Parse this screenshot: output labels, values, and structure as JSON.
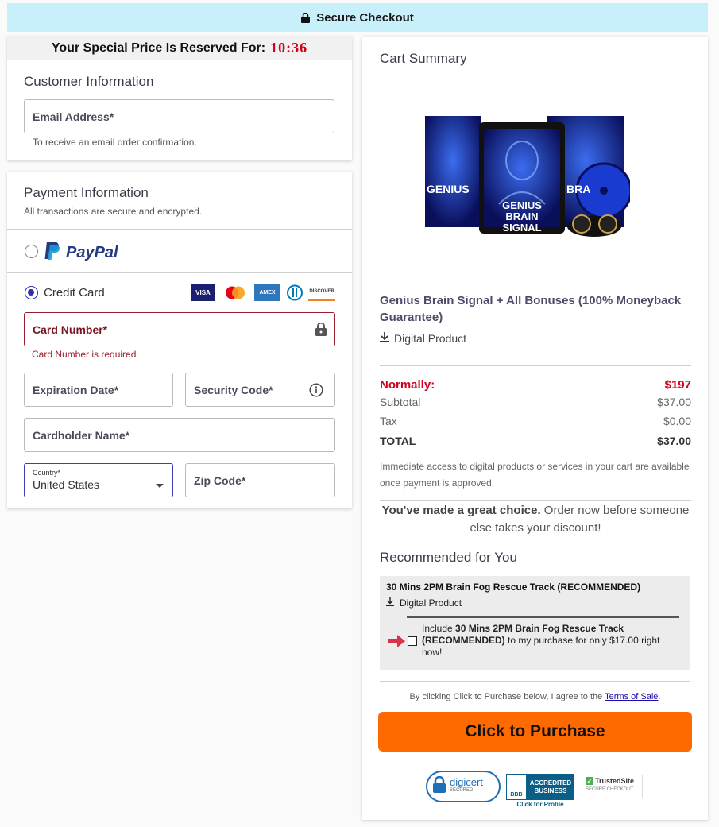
{
  "topbar": {
    "label": "Secure Checkout"
  },
  "timer": {
    "label": "Your Special Price Is Reserved For:",
    "time": "10:36"
  },
  "customer": {
    "title": "Customer Information",
    "email_label": "Email Address*",
    "email_help": "To receive an email order confirmation."
  },
  "payment": {
    "title": "Payment Information",
    "subtitle": "All transactions are secure and encrypted.",
    "paypal_label": "PayPal",
    "credit_label": "Credit Card",
    "card_logos": [
      "VISA",
      "AMEX",
      "DISCOVER"
    ],
    "card_number_label": "Card Number*",
    "card_number_error": "Card Number is required",
    "expiration_label": "Expiration Date*",
    "security_label": "Security Code*",
    "cardholder_label": "Cardholder Name*",
    "country_label": "Country*",
    "country_value": "United States",
    "zip_label": "Zip Code*"
  },
  "cart": {
    "title": "Cart Summary",
    "product_image_text_left": "GENIUS",
    "product_image_text_center": "GENIUS BRAIN SIGNAL",
    "product_image_text_right": "BRA",
    "product_name": "Genius Brain Signal + All Bonuses (100% Moneyback Guarantee)",
    "product_type": "Digital Product",
    "normally_label": "Normally:",
    "normally_price": "$197",
    "subtotal_label": "Subtotal",
    "subtotal_value": "$37.00",
    "tax_label": "Tax",
    "tax_value": "$0.00",
    "total_label": "TOTAL",
    "total_value": "$37.00",
    "access_note": "Immediate access to digital products or services in your cart are available once payment is approved.",
    "choice_bold": "You've made a great choice.",
    "choice_rest": " Order now before someone else takes your discount!",
    "rec_title": "Recommended for You",
    "rec_item_name": "30 Mins 2PM Brain Fog Rescue Track (RECOMMENDED)",
    "rec_item_type": "Digital Product",
    "rec_include_pre": "Include ",
    "rec_include_bold": "30 Mins 2PM Brain Fog Rescue Track (RECOMMENDED)",
    "rec_include_post": " to my purchase for only $17.00 right now!",
    "terms_pre": "By clicking Click to Purchase below, I agree to the ",
    "terms_link": "Terms of Sale",
    "terms_post": ".",
    "purchase_label": "Click to Purchase",
    "badge_digicert": "digicert",
    "badge_digicert_sub": "SECURED",
    "badge_bbb_line1": "ACCREDITED",
    "badge_bbb_line2": "BUSINESS",
    "badge_bbb_logo": "BBB",
    "badge_bbb_link": "Click for Profile",
    "badge_trusted": "TrustedSite",
    "badge_trusted_sub": "SECURE CHECKOUT"
  },
  "colors": {
    "accent": "#2d2db5",
    "error": "#9b1c2c",
    "button": "#ff6a00",
    "topbar": "#c8f0fa",
    "price_red": "#d0021b"
  }
}
